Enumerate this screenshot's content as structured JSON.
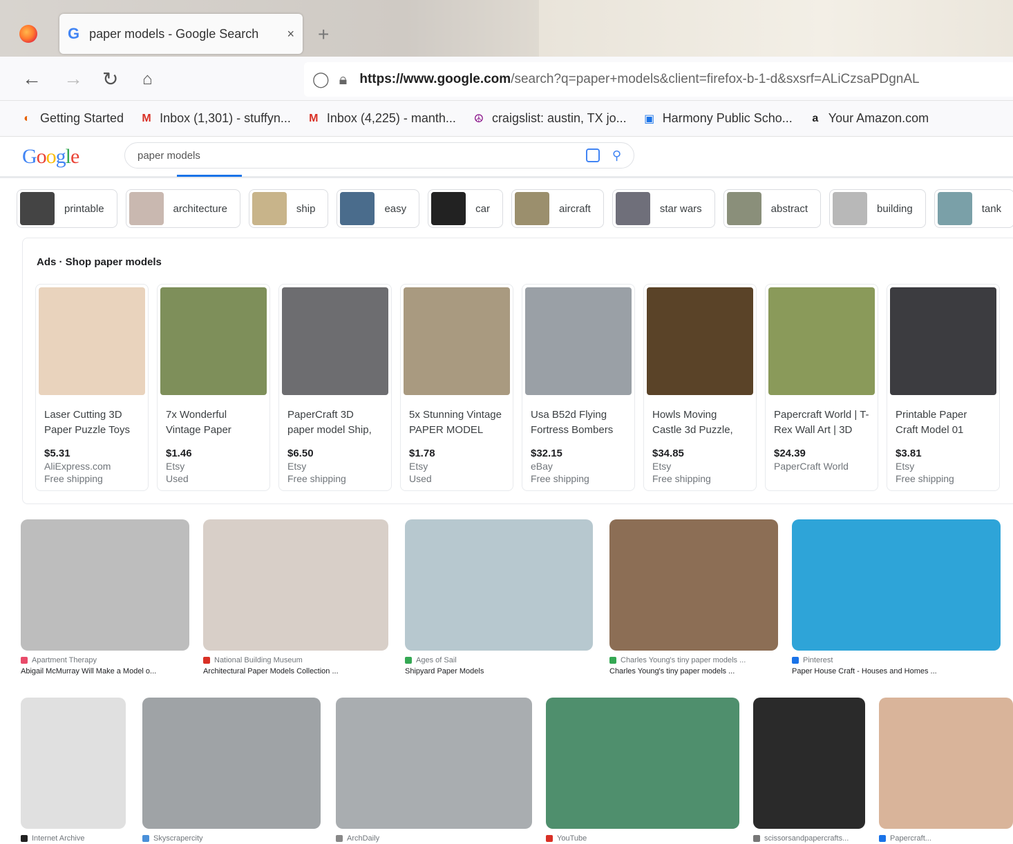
{
  "browser": {
    "tab_title": "paper models - Google Search",
    "tab_close": "×",
    "new_tab": "+",
    "url_host": "https://www.google.com",
    "url_rest": "/search?q=paper+models&client=firefox-b-1-d&sxsrf=ALiCzsaPDgnAL",
    "bookmarks": [
      {
        "label": "Getting Started",
        "icon": "firefox-icon",
        "color": "#e66000",
        "glyph": "◐"
      },
      {
        "label": "Inbox (1,301) - stuffyn...",
        "icon": "gmail-icon",
        "color": "#d93025",
        "glyph": "M"
      },
      {
        "label": "Inbox (4,225) - manth...",
        "icon": "gmail-icon",
        "color": "#d93025",
        "glyph": "M"
      },
      {
        "label": "craigslist: austin, TX jo...",
        "icon": "peace-icon",
        "color": "#800080",
        "glyph": "☮"
      },
      {
        "label": "Harmony Public Scho...",
        "icon": "school-icon",
        "color": "#1a73e8",
        "glyph": "▣"
      },
      {
        "label": "Your Amazon.com",
        "icon": "amazon-icon",
        "color": "#222222",
        "glyph": "a"
      }
    ]
  },
  "google": {
    "logo": "Google",
    "query": "paper models"
  },
  "chips": [
    {
      "label": "printable",
      "color": "#444"
    },
    {
      "label": "architecture",
      "color": "#c9b8b0"
    },
    {
      "label": "ship",
      "color": "#c8b48a"
    },
    {
      "label": "easy",
      "color": "#4a6c8c"
    },
    {
      "label": "car",
      "color": "#222222"
    },
    {
      "label": "aircraft",
      "color": "#9b8f6d"
    },
    {
      "label": "star wars",
      "color": "#6f6f7a"
    },
    {
      "label": "abstract",
      "color": "#8a8f7a"
    },
    {
      "label": "building",
      "color": "#b8b8b8"
    },
    {
      "label": "tank",
      "color": "#7aa0a8"
    }
  ],
  "ads": {
    "title": "Ads · Shop paper models",
    "items": [
      {
        "name": "Laser Cutting 3D Paper Puzzle Toys",
        "price": "$5.31",
        "seller": "AliExpress.com",
        "extra": "Free shipping",
        "color": "#e9d3bd"
      },
      {
        "name": "7x Wonderful Vintage Paper",
        "price": "$1.46",
        "seller": "Etsy",
        "extra": "Used",
        "color": "#7e8f5a"
      },
      {
        "name": "PaperCraft 3D paper model Ship,",
        "price": "$6.50",
        "seller": "Etsy",
        "extra": "Free shipping",
        "color": "#6d6d70"
      },
      {
        "name": "5x Stunning Vintage PAPER MODEL",
        "price": "$1.78",
        "seller": "Etsy",
        "extra": "Used",
        "color": "#a99a80"
      },
      {
        "name": "Usa B52d Flying Fortress Bombers",
        "price": "$32.15",
        "seller": "eBay",
        "extra": "Free shipping",
        "color": "#9aa0a6"
      },
      {
        "name": "Howls Moving Castle 3d Puzzle,",
        "price": "$34.85",
        "seller": "Etsy",
        "extra": "Free shipping",
        "color": "#5a4328"
      },
      {
        "name": "Papercraft World | T-Rex Wall Art | 3D",
        "price": "$24.39",
        "seller": "PaperCraft World",
        "extra": "",
        "color": "#8a9a5a"
      },
      {
        "name": "Printable Paper Craft Model 01",
        "price": "$3.81",
        "seller": "Etsy",
        "extra": "Free shipping",
        "color": "#3c3c40"
      }
    ]
  },
  "results_row1": [
    {
      "source": "Apartment Therapy",
      "title": "Abigail McMurray Will Make a Model o...",
      "color": "#bdbdbd",
      "src_color": "#e94b6a"
    },
    {
      "source": "National Building Museum",
      "title": "Architectural Paper Models Collection ...",
      "color": "#d8cfc8",
      "src_color": "#d93025"
    },
    {
      "source": "Ages of Sail",
      "title": "Shipyard Paper Models",
      "color": "#b7c8cf",
      "src_color": "#34a853"
    },
    {
      "source": "Charles Young's tiny paper models ...",
      "title": "Charles Young's tiny paper models ...",
      "color": "#8c6e55",
      "src_color": "#34a853"
    },
    {
      "source": "Pinterest",
      "title": "Paper House Craft - Houses and Homes ...",
      "color": "#2ea4d8",
      "src_color": "#1a73e8"
    }
  ],
  "results_row2": [
    {
      "source": "Internet Archive",
      "color": "#e0e0e0",
      "src_color": "#222222"
    },
    {
      "source": "Skyscrapercity",
      "color": "#9fa3a6",
      "src_color": "#4a90d9"
    },
    {
      "source": "ArchDaily",
      "color": "#a9adb0",
      "src_color": "#888888"
    },
    {
      "source": "YouTube",
      "color": "#4f8f6d",
      "src_color": "#d93025"
    },
    {
      "source": "scissorsandpapercrafts...",
      "color": "#2a2a2a",
      "src_color": "#777777"
    },
    {
      "source": "Papercraft...",
      "color": "#d9b49a",
      "src_color": "#1a73e8"
    }
  ]
}
